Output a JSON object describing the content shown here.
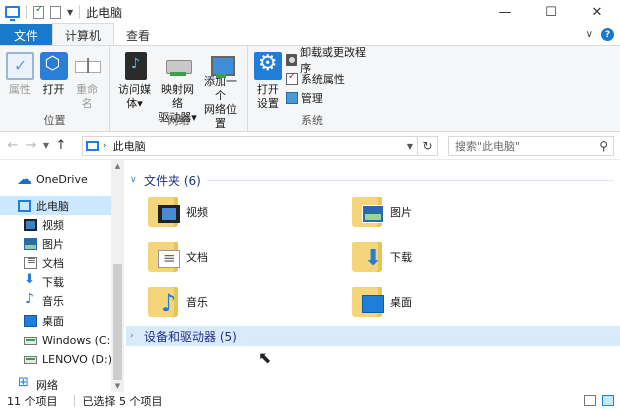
{
  "window": {
    "title": "此电脑",
    "controls": {
      "minimize": "—",
      "maximize": "☐",
      "close": "✕"
    }
  },
  "tabs": [
    {
      "label": "文件"
    },
    {
      "label": "计算机"
    },
    {
      "label": "查看"
    }
  ],
  "ribbon": {
    "location_group": {
      "label": "位置",
      "properties": "属性",
      "open": "打开",
      "rename": "重命名"
    },
    "network_group": {
      "label": "网络",
      "access_media_l1": "访问媒体",
      "map_drive_l1": "映射网络",
      "map_drive_l2": "驱动器",
      "add_location_l1": "添加一个",
      "add_location_l2": "网络位置"
    },
    "system_group": {
      "label": "系统",
      "open_settings_l1": "打开",
      "open_settings_l2": "设置",
      "uninstall": "卸载或更改程序",
      "system_properties": "系统属性",
      "manage": "管理"
    }
  },
  "address": {
    "path": "此电脑",
    "search_placeholder": "搜索\"此电脑\""
  },
  "nav": {
    "items": [
      {
        "label": "OneDrive",
        "icon": "onedrive-icon"
      },
      {
        "label": "此电脑",
        "icon": "pc-icon"
      },
      {
        "label": "视频",
        "icon": "videos-icon"
      },
      {
        "label": "图片",
        "icon": "pictures-icon"
      },
      {
        "label": "文档",
        "icon": "documents-icon"
      },
      {
        "label": "下载",
        "icon": "downloads-icon"
      },
      {
        "label": "音乐",
        "icon": "music-icon"
      },
      {
        "label": "桌面",
        "icon": "desktop-icon"
      },
      {
        "label": "Windows (C:)",
        "icon": "drive-icon"
      },
      {
        "label": "LENOVO (D:)",
        "icon": "drive-icon"
      },
      {
        "label": "网络",
        "icon": "network-icon"
      }
    ]
  },
  "content": {
    "folders_section": "文件夹 (6)",
    "folders": [
      {
        "label": "视频"
      },
      {
        "label": "图片"
      },
      {
        "label": "文档"
      },
      {
        "label": "下载"
      },
      {
        "label": "音乐"
      },
      {
        "label": "桌面"
      }
    ],
    "devices_section": "设备和驱动器 (5)"
  },
  "status": {
    "item_count": "11 个项目",
    "selected": "已选择 5 个项目"
  },
  "colors": {
    "accent": "#1979ca",
    "selection": "#cce8ff",
    "section_title": "#1e3287",
    "folder": "#f5d57a"
  }
}
